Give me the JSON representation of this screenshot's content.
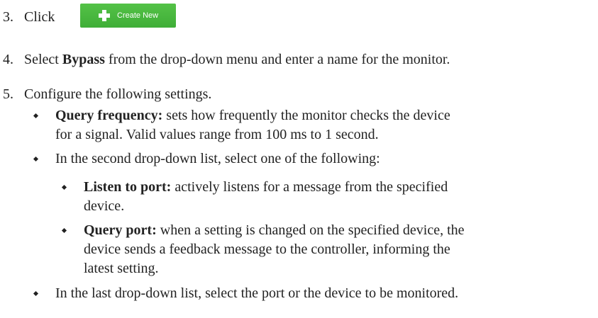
{
  "step3": {
    "number": "3.",
    "text": "Click",
    "button_label": "Create New"
  },
  "step4": {
    "number": "4.",
    "text_before": "Select",
    "bold": "Bypass",
    "text_after": "from the drop-down menu and enter a name for the monitor."
  },
  "step5": {
    "number": "5.",
    "text": "Configure the following settings.",
    "query_frequency": {
      "term": "Query frequency:",
      "line1": "sets how frequently the monitor checks the device",
      "line2": "for a signal. Valid values range from 100 ms to 1 second."
    },
    "second_dropdown": {
      "text": "In the second drop-down list, select one of the following:",
      "listen": {
        "term": "Listen to port:",
        "line1": "actively listens for a message from the specified",
        "line2": "device."
      },
      "query_port": {
        "term": "Query port:",
        "line1": "when a setting is changed on the specified device, the",
        "line2": "device sends a feedback message to the controller, informing the",
        "line3": "latest setting."
      }
    },
    "last_dropdown": {
      "text": "In the last drop-down list, select the port or the device to be monitored."
    }
  }
}
